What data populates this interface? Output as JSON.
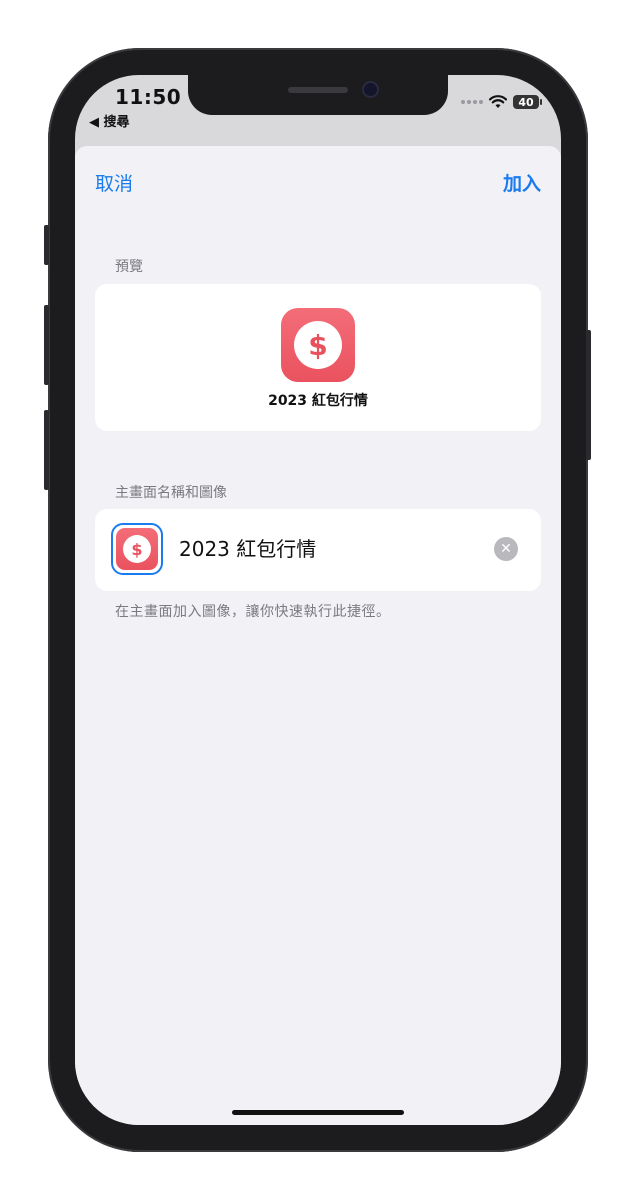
{
  "status_bar": {
    "time": "11:50",
    "back_label": "◀ 搜尋",
    "battery": "40",
    "wifi_icon": "wifi-icon"
  },
  "nav": {
    "cancel_label": "取消",
    "add_label": "加入"
  },
  "preview": {
    "section_label": "預覽",
    "app_name": "2023 紅包行情",
    "icon_glyph": "$"
  },
  "home_screen": {
    "section_label": "主畫面名稱和圖像",
    "name_value": "2023 紅包行情",
    "icon_glyph": "$",
    "clear_glyph": "✕",
    "footnote": "在主畫面加入圖像，讓你快速執行此捷徑。"
  },
  "colors": {
    "accent": "#1a7bef",
    "icon_red": "#ea525f",
    "sheet_bg": "#f2f1f6"
  }
}
